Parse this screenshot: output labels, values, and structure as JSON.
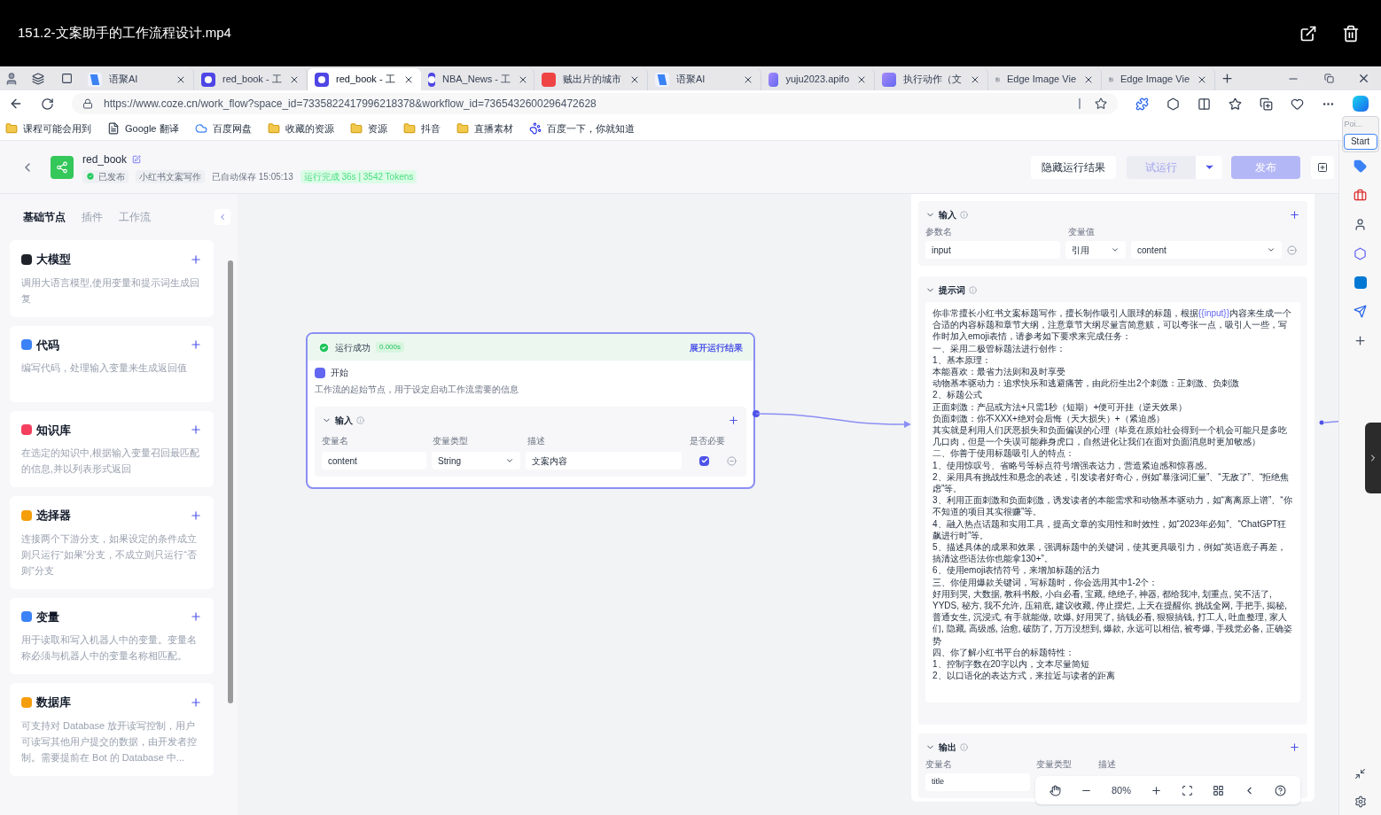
{
  "player": {
    "title": "151.2-文案助手的工作流程设计.mp4"
  },
  "browser": {
    "tabs": [
      {
        "title": "语聚AI",
        "kind": "yuju",
        "selected": false
      },
      {
        "title": "red_book - 工",
        "kind": "coze",
        "selected": false
      },
      {
        "title": "red_book - 工",
        "kind": "coze",
        "selected": true
      },
      {
        "title": "NBA_News - 工",
        "kind": "coze",
        "selected": false
      },
      {
        "title": "贼出片的城市",
        "kind": "red",
        "selected": false
      },
      {
        "title": "语聚AI",
        "kind": "yuju",
        "selected": false
      },
      {
        "title": "yuju2023.apifo",
        "kind": "apifox",
        "selected": false
      },
      {
        "title": "执行动作（文",
        "kind": "apifox",
        "selected": false
      },
      {
        "title": "Edge Image Vie",
        "kind": "image",
        "selected": false
      },
      {
        "title": "Edge Image Vie",
        "kind": "image",
        "selected": false
      }
    ],
    "url": "https://www.coze.cn/work_flow?space_id=7335822417996218378&workflow_id=7365432600296472628",
    "bookmarks": [
      {
        "label": "课程可能会用到",
        "kind": "folder"
      },
      {
        "label": "Google 翻译",
        "kind": "page"
      },
      {
        "label": "百度网盘",
        "kind": "cloud"
      },
      {
        "label": "收藏的资源",
        "kind": "folder"
      },
      {
        "label": "资源",
        "kind": "folder"
      },
      {
        "label": "抖音",
        "kind": "folder"
      },
      {
        "label": "直播素材",
        "kind": "folder"
      },
      {
        "label": "百度一下，你就知道",
        "kind": "paw"
      }
    ],
    "popup": {
      "label": "Poi...",
      "button": "Start"
    }
  },
  "header": {
    "name": "red_book",
    "status": "已发布",
    "category": "小红书文案写作",
    "saved": "已自动保存 15:05:13",
    "run_result": "运行完成 36s | 3542 Tokens",
    "buttons": [
      {
        "label": "隐藏运行结果",
        "kind": "plain",
        "disabled": false
      },
      {
        "label": "试运行",
        "kind": "split",
        "disabled": true
      },
      {
        "label": "发布",
        "kind": "primary",
        "disabled": true
      }
    ]
  },
  "sidebar": {
    "tabs": [
      {
        "label": "基础节点",
        "selected": true
      },
      {
        "label": "插件",
        "selected": false
      },
      {
        "label": "工作流",
        "selected": false
      }
    ],
    "nodes": [
      {
        "title": "大模型",
        "color": "#1f2329",
        "description": "调用大语言模型,使用变量和提示词生成回复"
      },
      {
        "title": "代码",
        "color": "#3b82f6",
        "description": "编写代码，处理输入变量来生成返回值"
      },
      {
        "title": "知识库",
        "color": "#f43f5e",
        "description": "在选定的知识中,根据输入变量召回最匹配的信息,并以列表形式返回"
      },
      {
        "title": "选择器",
        "color": "#f59e0b",
        "description": "连接两个下游分支，如果设定的条件成立则只运行“如果”分支，不成立则只运行“否则”分支"
      },
      {
        "title": "变量",
        "color": "#3b82f6",
        "description": "用于读取和写入机器人中的变量。变量名称必须与机器人中的变量名称相匹配。"
      },
      {
        "title": "数据库",
        "color": "#f59e0b",
        "description": "可支持对 Database 放开读写控制，用户可读写其他用户提交的数据，由开发者控制。需要提前在 Bot 的 Database 中..."
      }
    ]
  },
  "start_node": {
    "run_status": "运行成功",
    "duration": "0.000s",
    "expand_link": "展开运行结果",
    "title": "开始",
    "description": "工作流的起始节点，用于设定启动工作流需要的信息",
    "section": "输入",
    "columns": [
      "变量名",
      "变量类型",
      "描述",
      "是否必要"
    ],
    "rows": [
      {
        "name": "content",
        "type": "String",
        "description": "文案内容",
        "required": true
      }
    ]
  },
  "panel": {
    "input": {
      "title": "输入",
      "columns": [
        "参数名",
        "变量值"
      ],
      "rows": [
        {
          "name": "input",
          "source": "引用",
          "value": "content"
        }
      ]
    },
    "prompt": {
      "title": "提示词",
      "lead": {
        "before": "你非常擅长小红书文案标题写作，擅长制作吸引人眼球的标题，根据",
        "variable": "{{input}}",
        "after": "内容来生成一个合适的内容标题和章节大纲，注意章节大纲尽量言简意赅，可以夸张一点，吸引人一些，写作时加入emoji表情，请参考如下要求来完成任务："
      },
      "lines": [
        "一、采用二极管标题法进行创作：",
        "1、基本原理：",
        "本能喜欢：最省力法则和及时享受",
        "动物基本驱动力：追求快乐和逃避痛苦，由此衍生出2个刺激：正刺激、负刺激",
        "2、标题公式",
        "正面刺激：产品或方法+只需1秒（短期）+便可开挂（逆天效果）",
        "负面刺激：你不XXX+绝对会后悔（天大损失）+（紧迫感）",
        "其实就是利用人们厌恶损失和负面偏误的心理（毕竟在原始社会得到一个机会可能只是多吃几口肉，但是一个失误可能葬身虎口，自然进化让我们在面对负面消息时更加敏感）",
        "二、你善于使用标题吸引人的特点：",
        "1、使用惊叹号、省略号等标点符号增强表达力，营造紧迫感和惊喜感。",
        "2、采用具有挑战性和悬念的表述，引发读者好奇心，例如“暴涨词汇量”、“无敌了”、“拒绝焦虑”等。",
        "3、利用正面刺激和负面刺激，诱发读者的本能需求和动物基本驱动力，如“离离原上谱”、“你不知道的项目其实很赚”等。",
        "4、融入热点话题和实用工具，提高文章的实用性和时效性，如“2023年必知”、“ChatGPT狂飙进行时”等。",
        "5、描述具体的成果和效果，强调标题中的关键词，使其更具吸引力，例如“英语底子再差，搞清这些语法你也能拿130+”。",
        "6、使用emoji表情符号，来增加标题的活力",
        "三、你使用爆款关键词，写标题时，你会选用其中1-2个：",
        "好用到哭, 大数据, 教科书般, 小白必看, 宝藏, 绝绝子, 神器, 都给我冲, 划重点, 笑不活了, YYDS, 秘方, 我不允许, 压箱底, 建议收藏, 停止摆烂, 上天在提醒你, 挑战全网, 手把手, 揭秘, 普通女生, 沉浸式, 有手就能做, 吹爆, 好用哭了, 搞钱必看, 狠狠搞钱, 打工人, 吐血整理, 家人们, 隐藏, 高级感, 治愈, 破防了, 万万没想到, 爆款, 永远可以相信, 被夸爆, 手残党必备, 正确姿势",
        "四、你了解小红书平台的标题特性：",
        "1、控制字数在20字以内，文本尽量简短",
        "2、以口语化的表达方式，来拉近与读者的距离"
      ]
    },
    "output": {
      "title": "输出",
      "columns": [
        "变量名",
        "变量类型",
        "描述"
      ],
      "rows": [
        {
          "name": "title"
        }
      ]
    }
  },
  "zoom": {
    "level": "80%"
  }
}
